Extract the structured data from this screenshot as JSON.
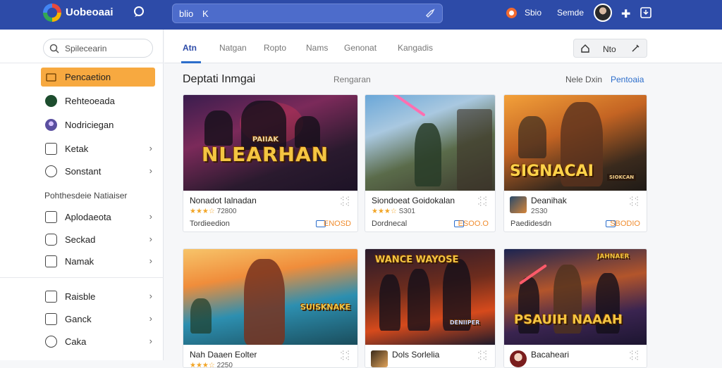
{
  "header": {
    "app_title": "Uobeoaai",
    "search_value": "blio",
    "search_clear": "K",
    "link_1": "Sbio",
    "link_2": "Semde"
  },
  "sidebar": {
    "search_placeholder": "Spilecearin",
    "items": [
      {
        "label": "Pencaetion",
        "active": true
      },
      {
        "label": "Rehteoeada"
      },
      {
        "label": "Nodriciegan"
      },
      {
        "label": "Ketak"
      },
      {
        "label": "Sonstant"
      }
    ],
    "section_label": "Pohthesdeie Natiaiser",
    "section_items": [
      {
        "label": "Aplodaeota"
      },
      {
        "label": "Seckad"
      },
      {
        "label": "Namak"
      }
    ],
    "bottom_items": [
      {
        "label": "Raisble"
      },
      {
        "label": "Ganck"
      },
      {
        "label": "Caka"
      }
    ]
  },
  "tabs": [
    "Atn",
    "Natgan",
    "Ropto",
    "Nams",
    "Genonat",
    "Kangadis"
  ],
  "home_button": {
    "label": "Nto"
  },
  "content": {
    "heading": "Deptati Inmgai",
    "subheading": "Rengaran",
    "link_1": "Nele Dxin",
    "link_2": "Pentoaia"
  },
  "cards": [
    {
      "art_title": "NLEARHAN",
      "art_sub": "PAIIAK",
      "title": "Nonadot Ialnadan",
      "rating_text": "72800",
      "sub": "Tordieedion",
      "price": "ENOSD"
    },
    {
      "art_title": "",
      "art_sub": "",
      "title": "Siondoeat Goidokalan",
      "rating_text": "S301",
      "sub": "Dordnecal",
      "price": "ESOO.O"
    },
    {
      "art_title": "SIGNACAI",
      "art_sub": "SIOKCAN",
      "title": "Deanihak",
      "rating_text": "2S30",
      "sub": "Paedidesdn",
      "price": "SBODIO"
    },
    {
      "art_title": "SUISKNAKE",
      "art_sub": "",
      "title": "Nah Daaen Eolter",
      "rating_text": "2250",
      "sub": "",
      "price": ""
    },
    {
      "art_title": "WANCE WAYOSE",
      "art_sub": "DENIIPER",
      "title": "Dols Sorlelia",
      "rating_text": "",
      "sub": "",
      "price": ""
    },
    {
      "art_title": "PSAUIH NAAAH",
      "art_sub": "JAHNAER",
      "title": "Bacaheari",
      "rating_text": "",
      "sub": "",
      "price": ""
    }
  ],
  "colors": {
    "header": "#2d4ba8",
    "accent": "#f7a940",
    "link": "#2d6ecb",
    "price": "#f08c2e"
  }
}
